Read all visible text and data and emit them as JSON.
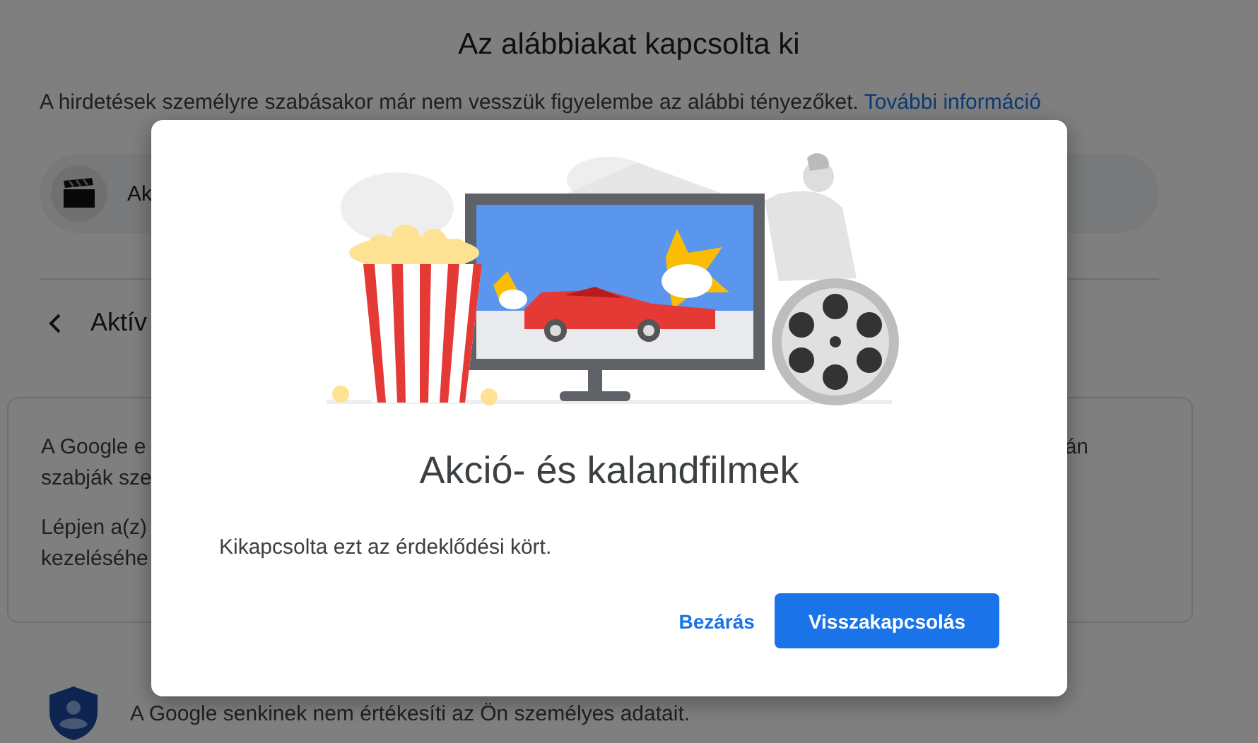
{
  "page": {
    "title": "Az alábbiakat kapcsolta ki",
    "description": {
      "text": "A hirdetések személyre szabásakor már nem vesszük figyelembe az alábbi tényezőket.",
      "link": "További információ"
    },
    "chip": {
      "label": "Ak"
    },
    "section": {
      "label": "Aktív"
    },
    "info_card": {
      "paragraphs": [
        [
          {
            "text": "A Google e",
            "trailing": "án"
          },
          {
            "text": "szabják sze"
          }
        ],
        [
          {
            "text": "Lépjen a(z)"
          },
          {
            "text": "kezeléséhe"
          }
        ]
      ]
    },
    "privacy_note": "A Google senkinek nem értékesíti az Ön személyes adatait."
  },
  "dialog": {
    "title": "Akció- és kalandfilmek",
    "message": "Kikapcsolta ezt az érdeklődési kört.",
    "buttons": [
      {
        "label": "Bezárás",
        "kind": "text"
      },
      {
        "label": "Visszakapcsolás",
        "kind": "filled"
      }
    ]
  }
}
